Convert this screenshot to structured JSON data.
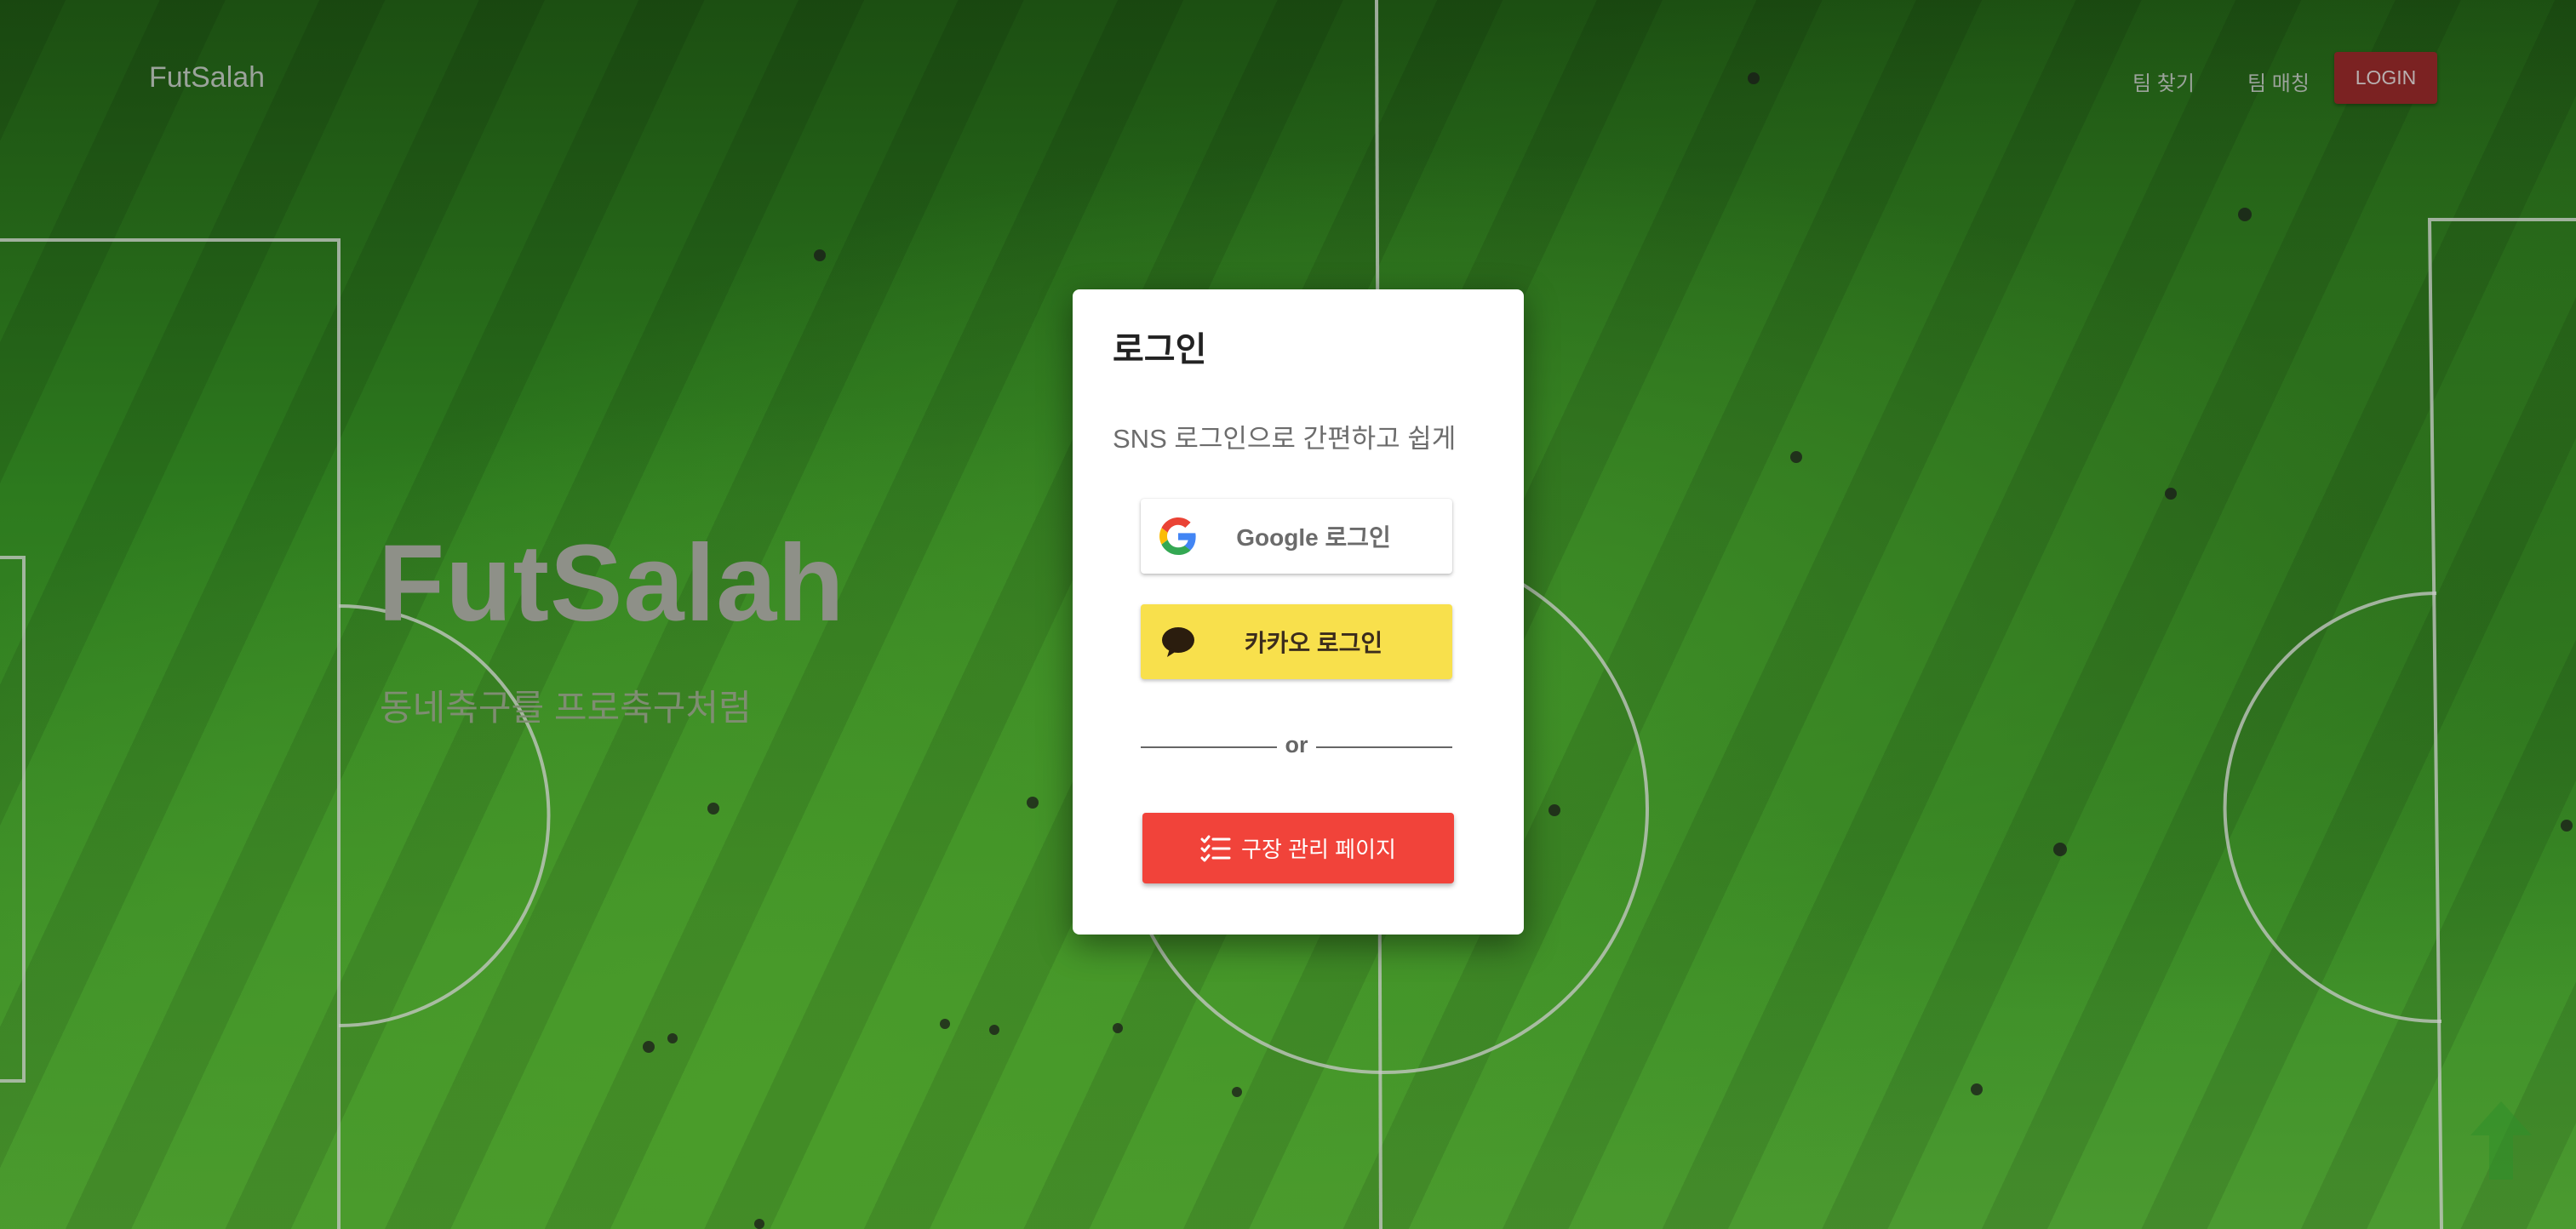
{
  "navbar": {
    "brand": "FutSalah",
    "links": [
      "팀 찾기",
      "팀 매칭"
    ],
    "login_label": "LOGIN"
  },
  "hero": {
    "title": "FutSalah",
    "subtitle": "동네축구를 프로축구처럼"
  },
  "login_modal": {
    "title": "로그인",
    "description": "SNS 로그인으로 간편하고 쉽게",
    "google_label": "Google 로그인",
    "kakao_label": "카카오 로그인",
    "divider_text": "or",
    "admin_label": "구장 관리 페이지"
  },
  "icons": {
    "google": "google-logo-icon",
    "kakao": "kakao-speech-bubble-icon",
    "admin": "checklist-icon",
    "scroll_top": "arrow-up-icon"
  },
  "colors": {
    "login_button": "#7b2222",
    "kakao_button": "#f8e04c",
    "admin_button": "#f1433a",
    "pitch": "#2d7a1e"
  }
}
